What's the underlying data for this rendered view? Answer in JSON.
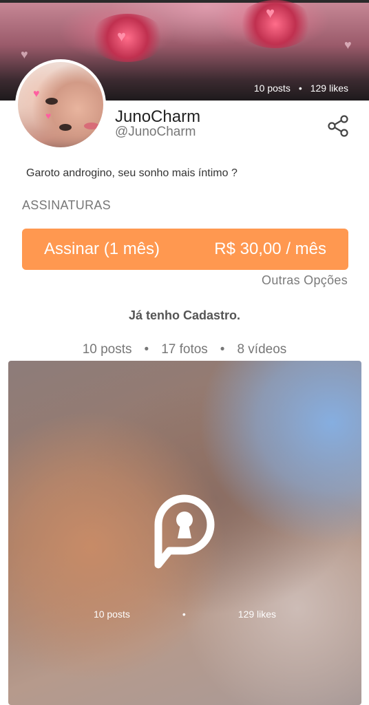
{
  "banner": {
    "posts": "10 posts",
    "likes": "129 likes",
    "separator": "•"
  },
  "profile": {
    "name": "JunoCharm",
    "handle": "@JunoCharm",
    "bio": "Garoto androgino, seu sonho mais íntimo ?"
  },
  "subscriptions": {
    "section_title": "ASSINATURAS",
    "plan_label": "Assinar (1 mês)",
    "plan_price": "R$ 30,00 / mês",
    "other_options": "Outras Opções"
  },
  "login_label": "Já tenho Cadastro.",
  "counts": {
    "posts": "10 posts",
    "photos": "17 fotos",
    "videos": "8 vídeos",
    "separator": "•"
  },
  "media_card": {
    "posts": "10 posts",
    "likes": "129 likes",
    "separator": "•",
    "icon": "lock-icon"
  },
  "colors": {
    "accent": "#ff9850",
    "text_muted": "#777777"
  }
}
